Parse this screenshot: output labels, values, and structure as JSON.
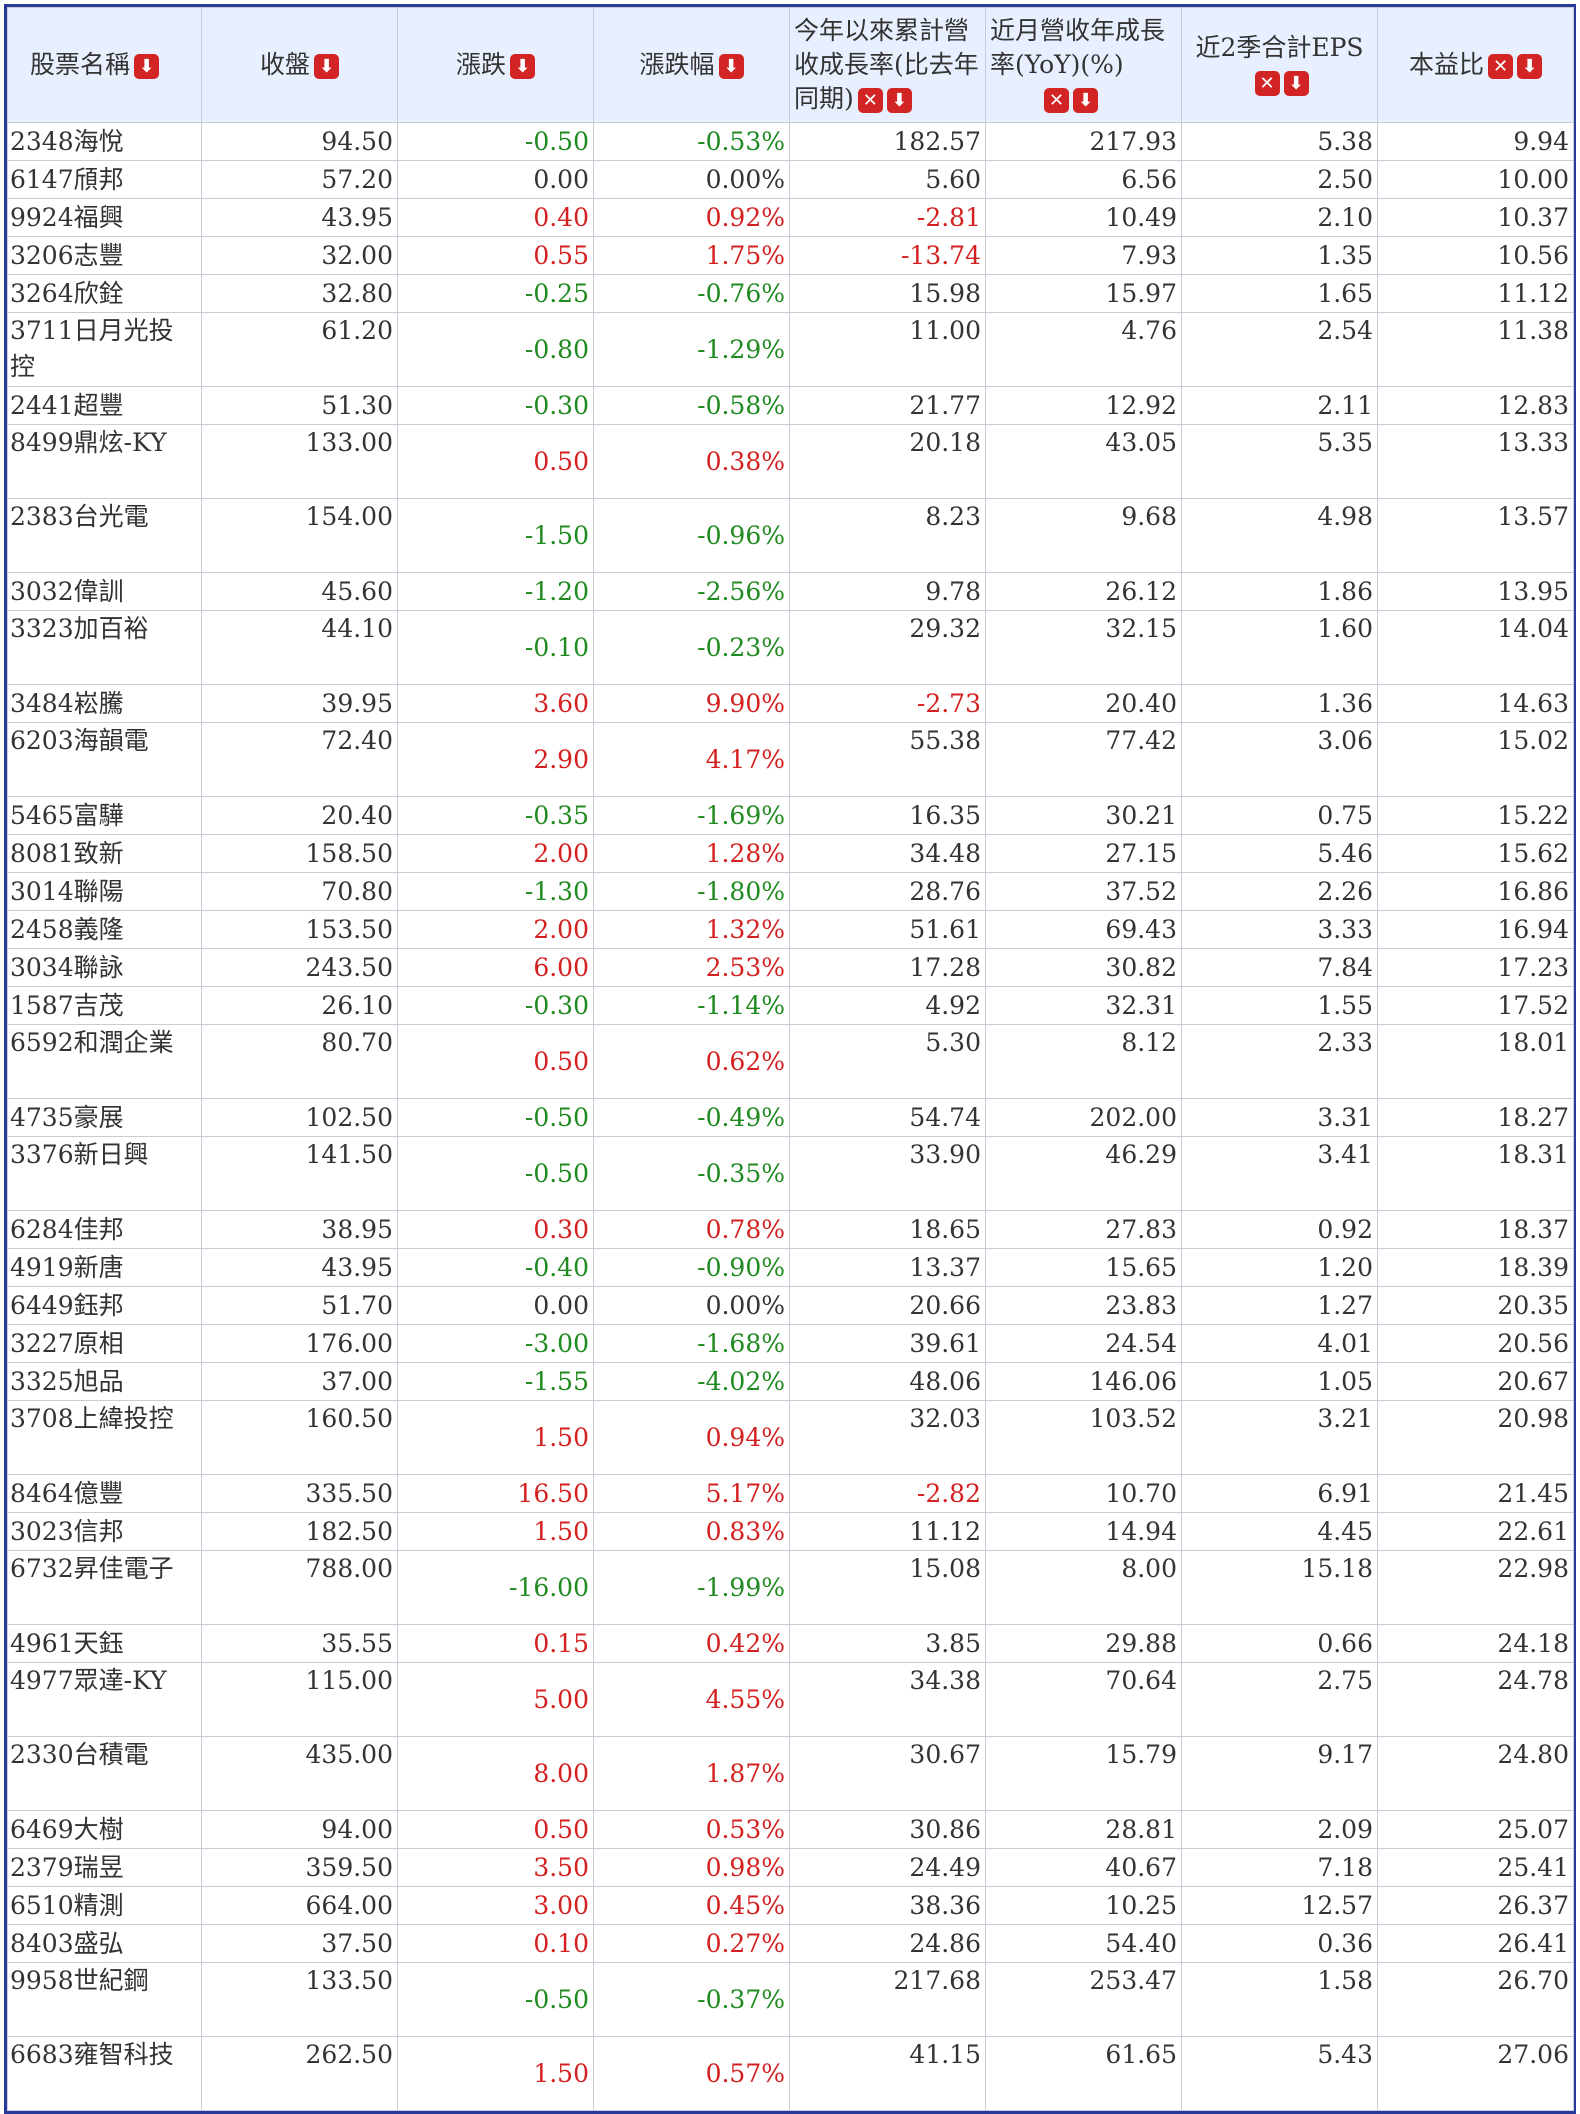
{
  "headers": {
    "name": "股票名稱",
    "close": "收盤",
    "change": "漲跌",
    "change_pct": "漲跌幅",
    "ytd_growth": "今年以來累計營收成長率(比去年同期)",
    "yoy": "近月營收年成長率(YoY)(%)",
    "eps2q": "近2季合計EPS",
    "pe": "本益比"
  },
  "icons": {
    "sort": "sort-down-icon",
    "remove": "remove-icon",
    "sort_glyph": "⬇",
    "remove_glyph": "✕"
  },
  "colors": {
    "up": "#d42020",
    "down": "#1f8a1f",
    "header_bg": "#e8f0ff",
    "border": "#2a3a9a"
  },
  "rows": [
    {
      "name": "2348海悅",
      "close": "94.50",
      "chg": "-0.50",
      "pct": "-0.53%",
      "ytd": "182.57",
      "yoy": "217.93",
      "eps": "5.38",
      "pe": "9.94"
    },
    {
      "name": "6147頎邦",
      "close": "57.20",
      "chg": "0.00",
      "pct": "0.00%",
      "ytd": "5.60",
      "yoy": "6.56",
      "eps": "2.50",
      "pe": "10.00"
    },
    {
      "name": "9924福興",
      "close": "43.95",
      "chg": "0.40",
      "pct": "0.92%",
      "ytd": "-2.81",
      "yoy": "10.49",
      "eps": "2.10",
      "pe": "10.37"
    },
    {
      "name": "3206志豐",
      "close": "32.00",
      "chg": "0.55",
      "pct": "1.75%",
      "ytd": "-13.74",
      "yoy": "7.93",
      "eps": "1.35",
      "pe": "10.56"
    },
    {
      "name": "3264欣銓",
      "close": "32.80",
      "chg": "-0.25",
      "pct": "-0.76%",
      "ytd": "15.98",
      "yoy": "15.97",
      "eps": "1.65",
      "pe": "11.12"
    },
    {
      "name": "3711日月光投控",
      "close": "61.20",
      "chg": "-0.80",
      "pct": "-1.29%",
      "ytd": "11.00",
      "yoy": "4.76",
      "eps": "2.54",
      "pe": "11.38"
    },
    {
      "name": "2441超豐",
      "close": "51.30",
      "chg": "-0.30",
      "pct": "-0.58%",
      "ytd": "21.77",
      "yoy": "12.92",
      "eps": "2.11",
      "pe": "12.83"
    },
    {
      "name": "8499鼎炫-KY",
      "close": "133.00",
      "chg": "0.50",
      "pct": "0.38%",
      "ytd": "20.18",
      "yoy": "43.05",
      "eps": "5.35",
      "pe": "13.33"
    },
    {
      "name": "2383台光電",
      "close": "154.00",
      "chg": "-1.50",
      "pct": "-0.96%",
      "ytd": "8.23",
      "yoy": "9.68",
      "eps": "4.98",
      "pe": "13.57"
    },
    {
      "name": "3032偉訓",
      "close": "45.60",
      "chg": "-1.20",
      "pct": "-2.56%",
      "ytd": "9.78",
      "yoy": "26.12",
      "eps": "1.86",
      "pe": "13.95"
    },
    {
      "name": "3323加百裕",
      "close": "44.10",
      "chg": "-0.10",
      "pct": "-0.23%",
      "ytd": "29.32",
      "yoy": "32.15",
      "eps": "1.60",
      "pe": "14.04"
    },
    {
      "name": "3484崧騰",
      "close": "39.95",
      "chg": "3.60",
      "pct": "9.90%",
      "ytd": "-2.73",
      "yoy": "20.40",
      "eps": "1.36",
      "pe": "14.63"
    },
    {
      "name": "6203海韻電",
      "close": "72.40",
      "chg": "2.90",
      "pct": "4.17%",
      "ytd": "55.38",
      "yoy": "77.42",
      "eps": "3.06",
      "pe": "15.02"
    },
    {
      "name": "5465富驊",
      "close": "20.40",
      "chg": "-0.35",
      "pct": "-1.69%",
      "ytd": "16.35",
      "yoy": "30.21",
      "eps": "0.75",
      "pe": "15.22"
    },
    {
      "name": "8081致新",
      "close": "158.50",
      "chg": "2.00",
      "pct": "1.28%",
      "ytd": "34.48",
      "yoy": "27.15",
      "eps": "5.46",
      "pe": "15.62"
    },
    {
      "name": "3014聯陽",
      "close": "70.80",
      "chg": "-1.30",
      "pct": "-1.80%",
      "ytd": "28.76",
      "yoy": "37.52",
      "eps": "2.26",
      "pe": "16.86"
    },
    {
      "name": "2458義隆",
      "close": "153.50",
      "chg": "2.00",
      "pct": "1.32%",
      "ytd": "51.61",
      "yoy": "69.43",
      "eps": "3.33",
      "pe": "16.94"
    },
    {
      "name": "3034聯詠",
      "close": "243.50",
      "chg": "6.00",
      "pct": "2.53%",
      "ytd": "17.28",
      "yoy": "30.82",
      "eps": "7.84",
      "pe": "17.23"
    },
    {
      "name": "1587吉茂",
      "close": "26.10",
      "chg": "-0.30",
      "pct": "-1.14%",
      "ytd": "4.92",
      "yoy": "32.31",
      "eps": "1.55",
      "pe": "17.52"
    },
    {
      "name": "6592和潤企業",
      "close": "80.70",
      "chg": "0.50",
      "pct": "0.62%",
      "ytd": "5.30",
      "yoy": "8.12",
      "eps": "2.33",
      "pe": "18.01"
    },
    {
      "name": "4735豪展",
      "close": "102.50",
      "chg": "-0.50",
      "pct": "-0.49%",
      "ytd": "54.74",
      "yoy": "202.00",
      "eps": "3.31",
      "pe": "18.27"
    },
    {
      "name": "3376新日興",
      "close": "141.50",
      "chg": "-0.50",
      "pct": "-0.35%",
      "ytd": "33.90",
      "yoy": "46.29",
      "eps": "3.41",
      "pe": "18.31"
    },
    {
      "name": "6284佳邦",
      "close": "38.95",
      "chg": "0.30",
      "pct": "0.78%",
      "ytd": "18.65",
      "yoy": "27.83",
      "eps": "0.92",
      "pe": "18.37"
    },
    {
      "name": "4919新唐",
      "close": "43.95",
      "chg": "-0.40",
      "pct": "-0.90%",
      "ytd": "13.37",
      "yoy": "15.65",
      "eps": "1.20",
      "pe": "18.39"
    },
    {
      "name": "6449鈺邦",
      "close": "51.70",
      "chg": "0.00",
      "pct": "0.00%",
      "ytd": "20.66",
      "yoy": "23.83",
      "eps": "1.27",
      "pe": "20.35"
    },
    {
      "name": "3227原相",
      "close": "176.00",
      "chg": "-3.00",
      "pct": "-1.68%",
      "ytd": "39.61",
      "yoy": "24.54",
      "eps": "4.01",
      "pe": "20.56"
    },
    {
      "name": "3325旭品",
      "close": "37.00",
      "chg": "-1.55",
      "pct": "-4.02%",
      "ytd": "48.06",
      "yoy": "146.06",
      "eps": "1.05",
      "pe": "20.67"
    },
    {
      "name": "3708上緯投控",
      "close": "160.50",
      "chg": "1.50",
      "pct": "0.94%",
      "ytd": "32.03",
      "yoy": "103.52",
      "eps": "3.21",
      "pe": "20.98"
    },
    {
      "name": "8464億豐",
      "close": "335.50",
      "chg": "16.50",
      "pct": "5.17%",
      "ytd": "-2.82",
      "yoy": "10.70",
      "eps": "6.91",
      "pe": "21.45"
    },
    {
      "name": "3023信邦",
      "close": "182.50",
      "chg": "1.50",
      "pct": "0.83%",
      "ytd": "11.12",
      "yoy": "14.94",
      "eps": "4.45",
      "pe": "22.61"
    },
    {
      "name": "6732昇佳電子",
      "close": "788.00",
      "chg": "-16.00",
      "pct": "-1.99%",
      "ytd": "15.08",
      "yoy": "8.00",
      "eps": "15.18",
      "pe": "22.98"
    },
    {
      "name": "4961天鈺",
      "close": "35.55",
      "chg": "0.15",
      "pct": "0.42%",
      "ytd": "3.85",
      "yoy": "29.88",
      "eps": "0.66",
      "pe": "24.18"
    },
    {
      "name": "4977眾達-KY",
      "close": "115.00",
      "chg": "5.00",
      "pct": "4.55%",
      "ytd": "34.38",
      "yoy": "70.64",
      "eps": "2.75",
      "pe": "24.78"
    },
    {
      "name": "2330台積電",
      "close": "435.00",
      "chg": "8.00",
      "pct": "1.87%",
      "ytd": "30.67",
      "yoy": "15.79",
      "eps": "9.17",
      "pe": "24.80"
    },
    {
      "name": "6469大樹",
      "close": "94.00",
      "chg": "0.50",
      "pct": "0.53%",
      "ytd": "30.86",
      "yoy": "28.81",
      "eps": "2.09",
      "pe": "25.07"
    },
    {
      "name": "2379瑞昱",
      "close": "359.50",
      "chg": "3.50",
      "pct": "0.98%",
      "ytd": "24.49",
      "yoy": "40.67",
      "eps": "7.18",
      "pe": "25.41"
    },
    {
      "name": "6510精測",
      "close": "664.00",
      "chg": "3.00",
      "pct": "0.45%",
      "ytd": "38.36",
      "yoy": "10.25",
      "eps": "12.57",
      "pe": "26.37"
    },
    {
      "name": "8403盛弘",
      "close": "37.50",
      "chg": "0.10",
      "pct": "0.27%",
      "ytd": "24.86",
      "yoy": "54.40",
      "eps": "0.36",
      "pe": "26.41"
    },
    {
      "name": "9958世紀鋼",
      "close": "133.50",
      "chg": "-0.50",
      "pct": "-0.37%",
      "ytd": "217.68",
      "yoy": "253.47",
      "eps": "1.58",
      "pe": "26.70"
    },
    {
      "name": "6683雍智科技",
      "close": "262.50",
      "chg": "1.50",
      "pct": "0.57%",
      "ytd": "41.15",
      "yoy": "61.65",
      "eps": "5.43",
      "pe": "27.06"
    }
  ]
}
